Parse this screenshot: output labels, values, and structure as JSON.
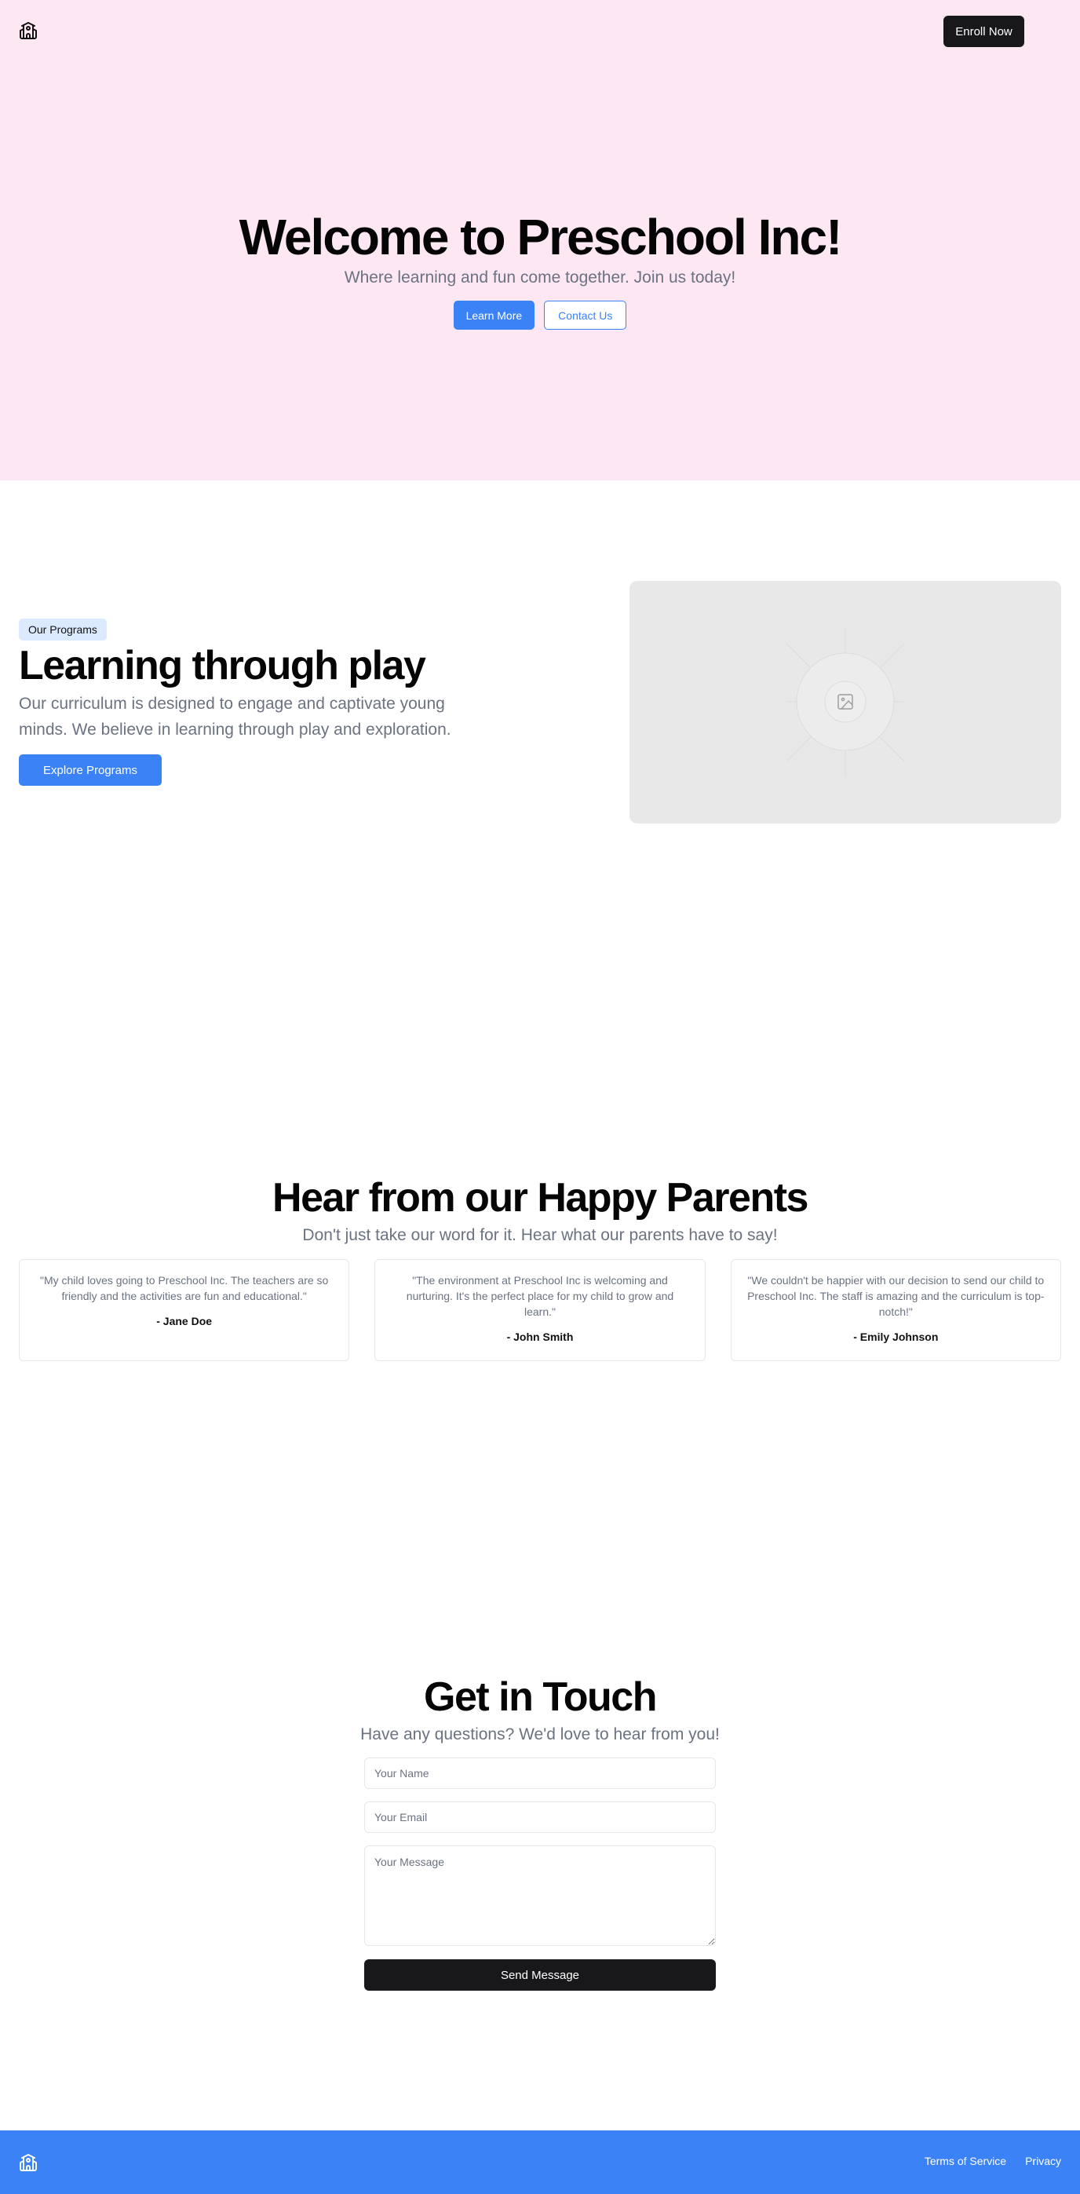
{
  "header": {
    "logo_icon": "school-icon",
    "enroll_label": "Enroll Now"
  },
  "hero": {
    "title": "Welcome to Preschool Inc!",
    "subtitle": "Where learning and fun come together. Join us today!",
    "learn_more_label": "Learn More",
    "contact_label": "Contact Us"
  },
  "programs": {
    "badge": "Our Programs",
    "title": "Learning through play",
    "description": "Our curriculum is designed to engage and captivate young minds. We believe in learning through play and exploration.",
    "explore_label": "Explore Programs",
    "image_icon": "image-placeholder-icon"
  },
  "testimonials": {
    "title": "Hear from our Happy Parents",
    "subtitle": "Don't just take our word for it. Hear what our parents have to say!",
    "items": [
      {
        "quote": "\"My child loves going to Preschool Inc. The teachers are so friendly and the activities are fun and educational.\"",
        "author": "- Jane Doe"
      },
      {
        "quote": "\"The environment at Preschool Inc is welcoming and nurturing. It's the perfect place for my child to grow and learn.\"",
        "author": "- John Smith"
      },
      {
        "quote": "\"We couldn't be happier with our decision to send our child to Preschool Inc. The staff is amazing and the curriculum is top-notch!\"",
        "author": "- Emily Johnson"
      }
    ]
  },
  "contact": {
    "title": "Get in Touch",
    "subtitle": "Have any questions? We'd love to hear from you!",
    "name_placeholder": "Your Name",
    "email_placeholder": "Your Email",
    "message_placeholder": "Your Message",
    "send_label": "Send Message"
  },
  "footer": {
    "logo_icon": "school-icon",
    "terms_label": "Terms of Service",
    "privacy_label": "Privacy"
  },
  "colors": {
    "hero_bg": "#fde7f3",
    "accent": "#3b82f6",
    "dark_button": "#18181b",
    "muted_text": "#6b7280"
  }
}
